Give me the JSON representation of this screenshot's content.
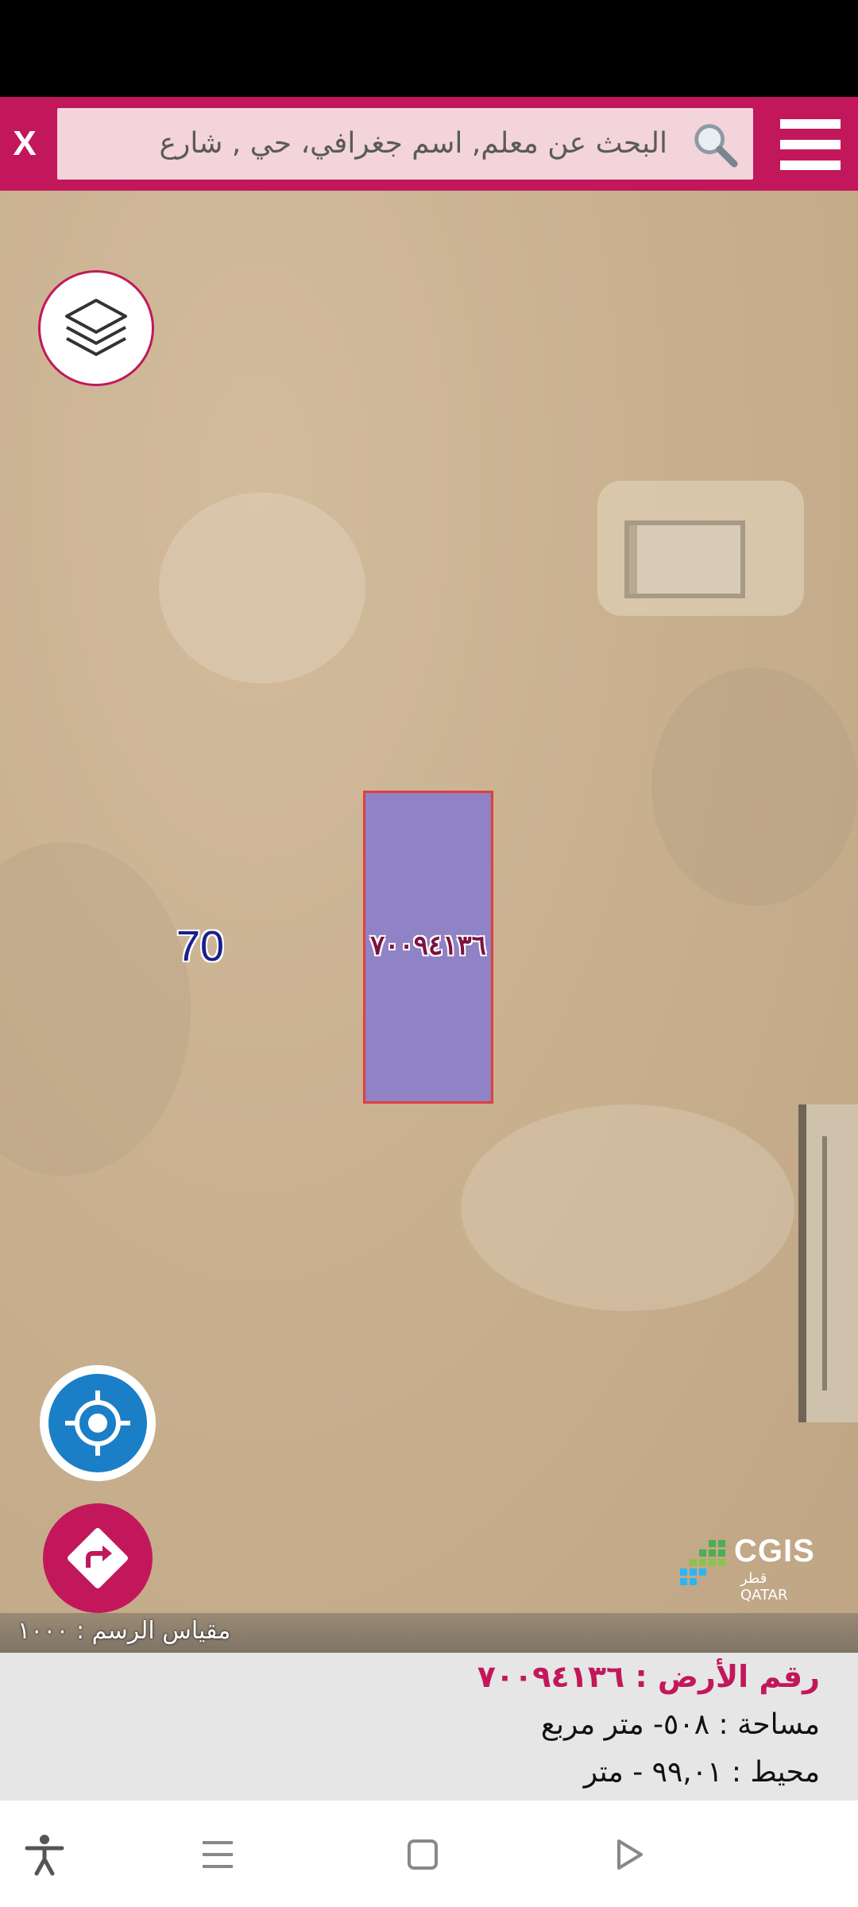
{
  "search": {
    "placeholder": "البحث عن معلم, اسم جغرافي، حي , شارع",
    "close_label": "X"
  },
  "map": {
    "zone_label": "70",
    "parcel_label": "٧٠٠٩٤١٣٦",
    "logo_text": "CGIS",
    "logo_sub": "قطر QATAR",
    "scale_text": "مقياس الرسم : ١٠٠٠"
  },
  "parcel_info": {
    "title": "رقم الأرض : ٧٠٠٩٤١٣٦",
    "area": "مساحة   :  ٥٠٨- متر مربع",
    "perimeter": "محيط   :  ٩٩,٠١ - متر"
  },
  "colors": {
    "accent": "#c2185b",
    "locate_blue": "#1a7fc6",
    "parcel_fill": "#8c80c8",
    "parcel_border": "#e23a3a"
  },
  "icons": [
    "close-icon",
    "search-icon",
    "menu-icon",
    "layers-icon",
    "locate-icon",
    "directions-icon",
    "accessibility-icon",
    "recent-apps-icon",
    "home-icon",
    "back-icon"
  ]
}
